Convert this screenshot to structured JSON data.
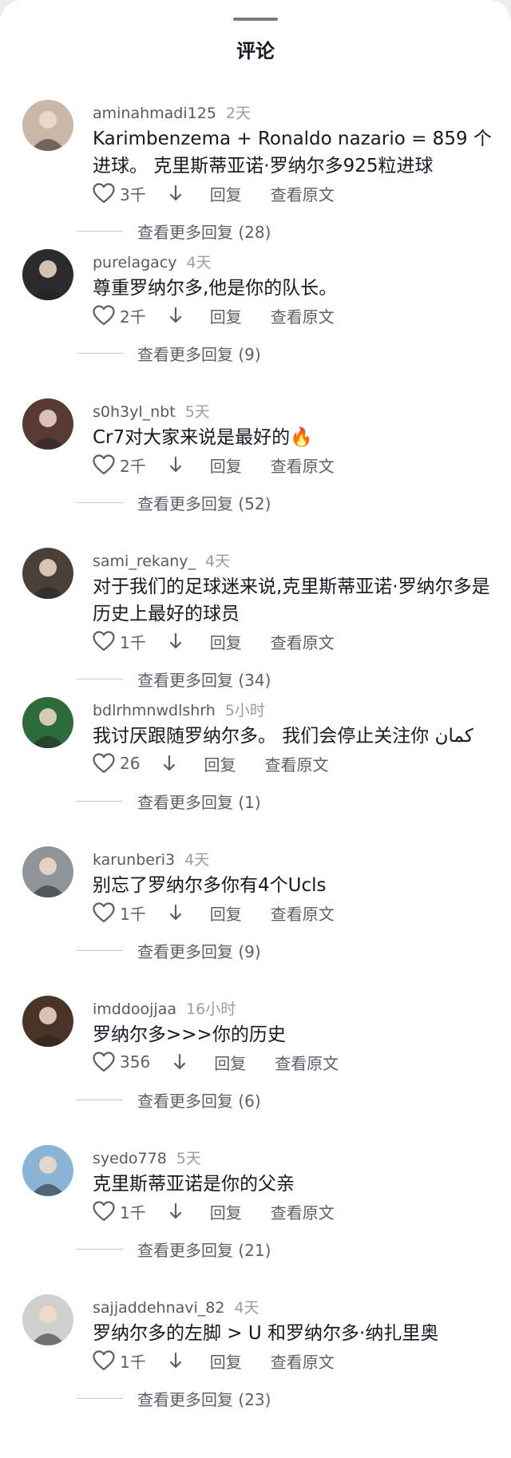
{
  "header": {
    "title": "评论"
  },
  "comments": [
    {
      "username": "aminahmadi125",
      "time": "2天",
      "text": "Karimbenzema + Ronaldo nazario = 859 个进球。 克里斯蒂亚诺·罗纳尔多925粒进球",
      "likes": "3千",
      "reply_label": "回复",
      "original_label": "查看原文",
      "more_replies": "查看更多回复 (28)",
      "avatar_color": "#c9b8a8"
    },
    {
      "username": "purelagacy",
      "time": "4天",
      "text": "尊重罗纳尔多,他是你的队长。",
      "likes": "2千",
      "reply_label": "回复",
      "original_label": "查看原文",
      "more_replies": "查看更多回复 (9)",
      "avatar_color": "#2b2b2f"
    },
    {
      "username": "s0h3yl_nbt",
      "time": "5天",
      "text": "Cr7对大家来说是最好的🔥",
      "likes": "2千",
      "reply_label": "回复",
      "original_label": "查看原文",
      "more_replies": "查看更多回复 (52)",
      "avatar_color": "#5a3a34"
    },
    {
      "username": "sami_rekany_",
      "time": "4天",
      "text": "对于我们的足球迷来说,克里斯蒂亚诺·罗纳尔多是历史上最好的球员",
      "likes": "1千",
      "reply_label": "回复",
      "original_label": "查看原文",
      "more_replies": "查看更多回复 (34)",
      "avatar_color": "#4a4038"
    },
    {
      "username": "bdlrhmnwdlshrh",
      "time": "5小时",
      "text": "我讨厌跟随罗纳尔多。 我们会停止关注你 كمان",
      "likes": "26",
      "reply_label": "回复",
      "original_label": "查看原文",
      "more_replies": "查看更多回复 (1)",
      "avatar_color": "#2d6b3a"
    },
    {
      "username": "karunberi3",
      "time": "4天",
      "text": "别忘了罗纳尔多你有4个Ucls",
      "likes": "1千",
      "reply_label": "回复",
      "original_label": "查看原文",
      "more_replies": "查看更多回复 (9)",
      "avatar_color": "#8f9499"
    },
    {
      "username": "imddoojjaa",
      "time": "16小时",
      "text": "罗纳尔多>>>你的历史",
      "likes": "356",
      "reply_label": "回复",
      "original_label": "查看原文",
      "more_replies": "查看更多回复 (6)",
      "avatar_color": "#4b3328"
    },
    {
      "username": "syedo778",
      "time": "5天",
      "text": "克里斯蒂亚诺是你的父亲",
      "likes": "1千",
      "reply_label": "回复",
      "original_label": "查看原文",
      "more_replies": "查看更多回复 (21)",
      "avatar_color": "#8ab4d6"
    },
    {
      "username": "sajjaddehnavi_82",
      "time": "4天",
      "text": "罗纳尔多的左脚 > U 和罗纳尔多·纳扎里奥",
      "likes": "1千",
      "reply_label": "回复",
      "original_label": "查看原文",
      "more_replies": "查看更多回复 (23)",
      "avatar_color": "#d2d0cc"
    }
  ]
}
